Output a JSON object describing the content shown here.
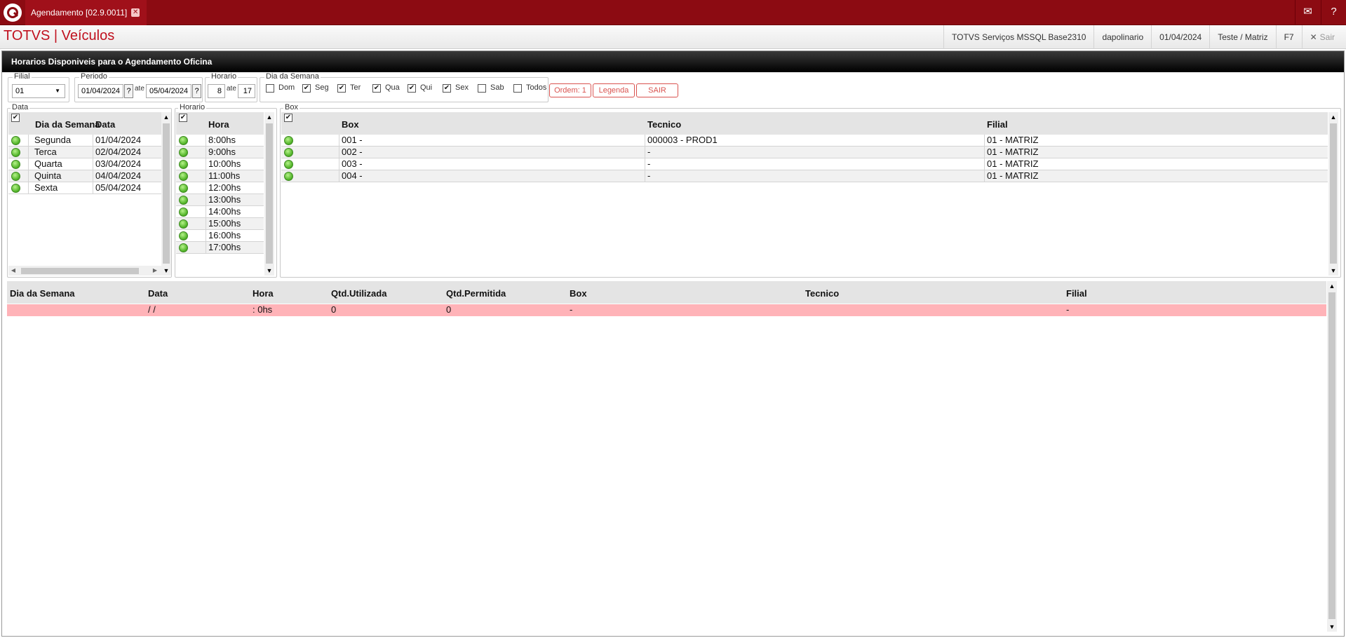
{
  "topbar": {
    "tab_title": "Agendamento [02.9.0011]",
    "tab_close_glyph": "✕",
    "mail_glyph": "✉",
    "help_glyph": "?"
  },
  "header": {
    "app_title": "TOTVS | Veículos",
    "info": [
      "TOTVS Serviços MSSQL Base2310",
      "dapolinario",
      "01/04/2024",
      "Teste / Matriz",
      "F7"
    ],
    "sair_glyph": "✕",
    "sair_label": "Sair"
  },
  "dialog": {
    "title": "Horarios Disponiveis para o Agendamento Oficina"
  },
  "filters": {
    "filial_legend": "Filial",
    "filial_value": "01",
    "periodo_legend": "Periodo",
    "periodo_from": "01/04/2024",
    "periodo_to": "05/04/2024",
    "horario_legend": "Horario",
    "horario_from": "8",
    "horario_to": "17",
    "ate_label": "ate",
    "question_glyph": "?",
    "dia_semana_legend": "Dia da Semana",
    "days": [
      {
        "label": "Dom",
        "checked": false
      },
      {
        "label": "Seg",
        "checked": true
      },
      {
        "label": "Ter",
        "checked": true
      },
      {
        "label": "Qua",
        "checked": true
      },
      {
        "label": "Qui",
        "checked": true
      },
      {
        "label": "Sex",
        "checked": true
      },
      {
        "label": "Sab",
        "checked": false
      },
      {
        "label": "Todos",
        "checked": false
      }
    ],
    "check_glyph": "✔",
    "buttons": {
      "ordem": "Ordem: 1",
      "legenda": "Legenda",
      "sair": "SAIR"
    }
  },
  "data_panel": {
    "legend": "Data",
    "headers": [
      "Dia da Semana",
      "Data"
    ],
    "rows": [
      [
        "Segunda",
        "01/04/2024"
      ],
      [
        "Terca",
        "02/04/2024"
      ],
      [
        "Quarta",
        "03/04/2024"
      ],
      [
        "Quinta",
        "04/04/2024"
      ],
      [
        "Sexta",
        "05/04/2024"
      ]
    ]
  },
  "horario_panel": {
    "legend": "Horario",
    "headers": [
      "Hora"
    ],
    "rows": [
      "8:00hs",
      "9:00hs",
      "10:00hs",
      "11:00hs",
      "12:00hs",
      "13:00hs",
      "14:00hs",
      "15:00hs",
      "16:00hs",
      "17:00hs"
    ]
  },
  "box_panel": {
    "legend": "Box",
    "headers": [
      "Box",
      "Tecnico",
      "Filial"
    ],
    "rows": [
      [
        "001 -",
        "000003 - PROD1",
        "01 - MATRIZ"
      ],
      [
        "002 -",
        "-",
        "01 - MATRIZ"
      ],
      [
        "003 -",
        "-",
        "01 - MATRIZ"
      ],
      [
        "004 -",
        "-",
        "01 - MATRIZ"
      ]
    ]
  },
  "result": {
    "headers": [
      "Dia da Semana",
      "Data",
      "Hora",
      "Qtd.Utilizada",
      "Qtd.Permitida",
      "Box",
      "Tecnico",
      "Filial"
    ],
    "rows": [
      [
        "",
        "/ /",
        ": 0hs",
        "0",
        "0",
        "-",
        "",
        "-"
      ]
    ]
  },
  "scroll": {
    "up": "▲",
    "down": "▼",
    "left": "◀",
    "right": "▶"
  },
  "colors": {
    "brand": "#8c0b12",
    "title": "#c0101e",
    "accent_red": "#d9534f",
    "row_highlight": "#ffb3b8",
    "status_green": "#53b52a"
  }
}
